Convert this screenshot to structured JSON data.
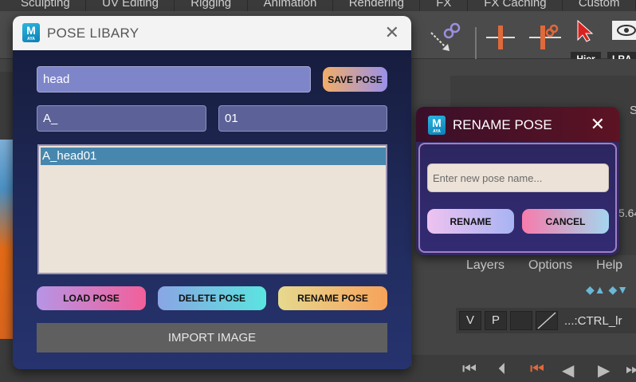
{
  "background": {
    "menu_tabs": [
      "Sculpting",
      "UV Editing",
      "Rigging",
      "Animation",
      "Rendering",
      "FX",
      "FX Caching",
      "Custom"
    ],
    "shelf_labels": {
      "hier": "Hier",
      "lra": "LRA"
    },
    "right_panel": {
      "s_text": "S",
      "number_text": "5.64",
      "layer_menu": [
        "Layers",
        "Options",
        "Help"
      ],
      "layer_row": {
        "v": "V",
        "p": "P",
        "name": "...:CTRL_lr"
      }
    }
  },
  "pose_library": {
    "title": "POSE LIBARY",
    "logo_letter": "M",
    "logo_sub": "AYA",
    "search_value": "head",
    "save_label": "SAVE POSE",
    "prefix_value": "A_",
    "number_value": "01",
    "list_items": [
      "A_head01"
    ],
    "load_label": "LOAD POSE",
    "delete_label": "DELETE POSE",
    "rename_label": "RENAME POSE",
    "import_label": "IMPORT IMAGE",
    "colors": {
      "title_bar": "#f3f3f3",
      "body_top": "#151a38",
      "body_bottom": "#26336e",
      "selection": "#4787ae"
    }
  },
  "rename_dialog": {
    "title": "RENAME POSE",
    "logo_letter": "M",
    "logo_sub": "AYA",
    "input_placeholder": "Enter new pose name...",
    "rename_label": "RENAME",
    "cancel_label": "CANCEL",
    "colors": {
      "title_bar": "#4a1226",
      "border": "#a27fc0",
      "body": "#2f2963"
    }
  }
}
